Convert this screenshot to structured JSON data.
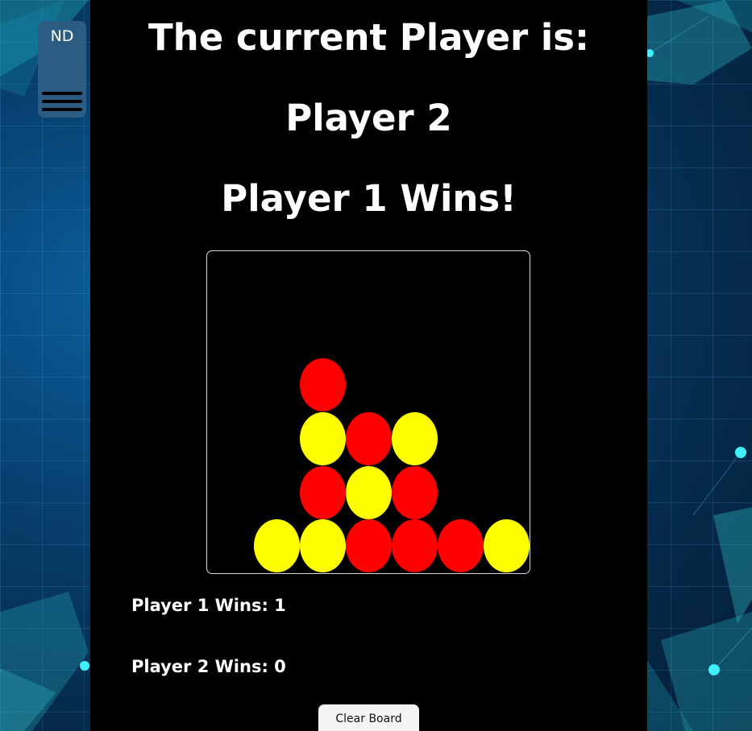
{
  "header": {
    "current_label": "The current Player is:",
    "current_player": "Player 2",
    "winner_message": "Player 1 Wins!"
  },
  "nav": {
    "initials": "ND",
    "menu_icon": "hamburger-menu-icon"
  },
  "board": {
    "columns": 7,
    "rows": 6,
    "colors": {
      "player1": "#ff0000",
      "player2": "#ffff00",
      "empty": "#000000"
    },
    "pieces": [
      {
        "col": 2,
        "row": 2,
        "player": 1
      },
      {
        "col": 2,
        "row": 3,
        "player": 2
      },
      {
        "col": 3,
        "row": 3,
        "player": 1
      },
      {
        "col": 4,
        "row": 3,
        "player": 2
      },
      {
        "col": 2,
        "row": 4,
        "player": 1
      },
      {
        "col": 3,
        "row": 4,
        "player": 2
      },
      {
        "col": 4,
        "row": 4,
        "player": 1
      },
      {
        "col": 1,
        "row": 5,
        "player": 2
      },
      {
        "col": 2,
        "row": 5,
        "player": 2
      },
      {
        "col": 3,
        "row": 5,
        "player": 1
      },
      {
        "col": 4,
        "row": 5,
        "player": 1
      },
      {
        "col": 5,
        "row": 5,
        "player": 1
      },
      {
        "col": 6,
        "row": 5,
        "player": 2
      }
    ]
  },
  "scores": {
    "player1_label": "Player 1 Wins: 1",
    "player2_label": "Player 2 Wins: 0"
  },
  "controls": {
    "clear_label": "Clear Board"
  },
  "theme": {
    "panel_bg": "#000000",
    "nav_bg": "#2d5c83",
    "text": "#ffffff"
  }
}
